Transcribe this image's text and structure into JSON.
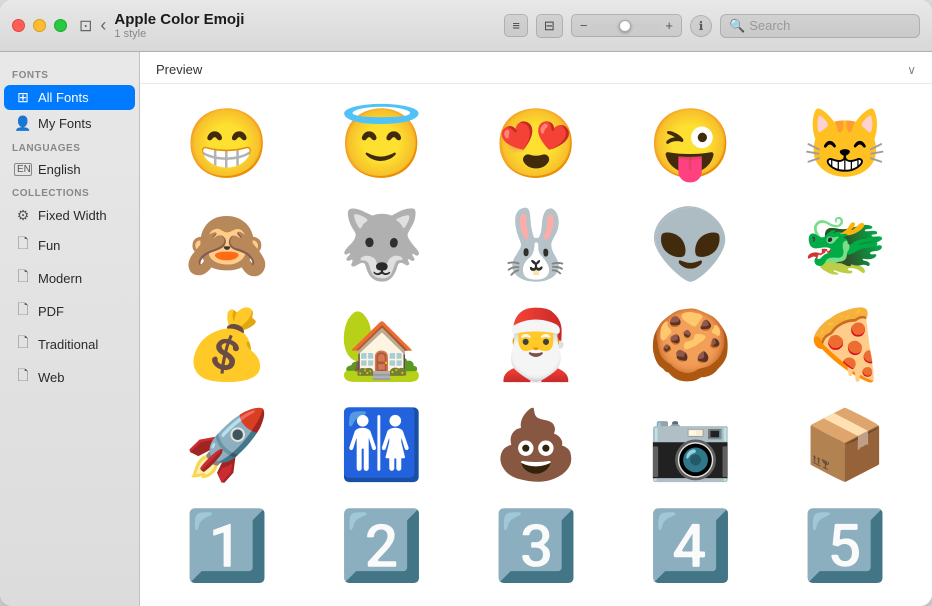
{
  "window": {
    "title": "Apple Color Emoji",
    "subtitle": "1 style"
  },
  "titlebar": {
    "back_label": "‹",
    "sidebar_toggle": "⊡",
    "list_view_icon": "≡",
    "strip_view_icon": "⊟",
    "size_minus": "−",
    "size_plus": "+",
    "info_icon": "ℹ",
    "search_placeholder": "Search"
  },
  "sidebar": {
    "fonts_label": "Fonts",
    "all_fonts_label": "All Fonts",
    "my_fonts_label": "My Fonts",
    "languages_label": "Languages",
    "english_label": "English",
    "collections_label": "Collections",
    "collections": [
      {
        "label": "Fixed Width",
        "icon": "⚙"
      },
      {
        "label": "Fun",
        "icon": "🗋"
      },
      {
        "label": "Modern",
        "icon": "🗋"
      },
      {
        "label": "PDF",
        "icon": "🗋"
      },
      {
        "label": "Traditional",
        "icon": "🗋"
      },
      {
        "label": "Web",
        "icon": "🗋"
      }
    ]
  },
  "preview": {
    "label": "Preview",
    "emojis": [
      "😁",
      "😇",
      "😍",
      "😜",
      "😸",
      "🙈",
      "🐺",
      "🐰",
      "👽",
      "🐲",
      "💰",
      "🏡",
      "🎅",
      "🍪",
      "🍕",
      "🚀",
      "🚻",
      "💩",
      "📷",
      "📦",
      "1️⃣",
      "2️⃣",
      "3️⃣",
      "4️⃣",
      "5️⃣"
    ]
  }
}
